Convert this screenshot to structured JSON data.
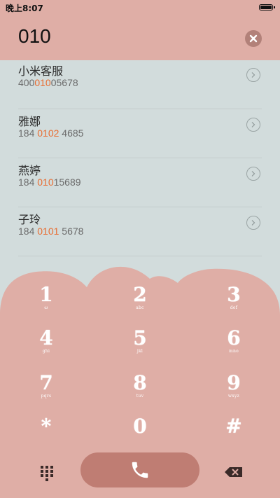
{
  "status_bar": {
    "time": "晚上8:07",
    "battery_icon": "battery-icon"
  },
  "dialer": {
    "number": "010",
    "clear_icon": "close-icon"
  },
  "contacts": [
    {
      "name": "小米客服",
      "number_parts": [
        "400",
        "010",
        "05678"
      ]
    },
    {
      "name": "雅娜",
      "number_parts": [
        "184 ",
        "0102",
        " 4685"
      ]
    },
    {
      "name": "燕婷",
      "number_parts": [
        "184 ",
        "010",
        "15689"
      ]
    },
    {
      "name": "子玲",
      "number_parts": [
        "184 ",
        "0101",
        " 5678"
      ]
    }
  ],
  "keys": [
    {
      "digit": "1",
      "letters": "ω"
    },
    {
      "digit": "2",
      "letters": "abc"
    },
    {
      "digit": "3",
      "letters": "def"
    },
    {
      "digit": "4",
      "letters": "ghi"
    },
    {
      "digit": "5",
      "letters": "jkl"
    },
    {
      "digit": "6",
      "letters": "mno"
    },
    {
      "digit": "7",
      "letters": "pqrs"
    },
    {
      "digit": "8",
      "letters": "tuv"
    },
    {
      "digit": "9",
      "letters": "wxyz"
    },
    {
      "digit": "*",
      "letters": ""
    },
    {
      "digit": "0",
      "letters": ""
    },
    {
      "digit": "#",
      "letters": ""
    }
  ],
  "bottom_bar": {
    "keypad_icon": "dialpad-grid-icon",
    "call_icon": "phone-icon",
    "backspace_icon": "backspace-icon"
  },
  "colors": {
    "header": "#dfaea6",
    "list_background": "#d2dcdc",
    "dialpad": "#dfaea6",
    "call_button": "#bf7d73",
    "highlight": "#e86d32"
  }
}
